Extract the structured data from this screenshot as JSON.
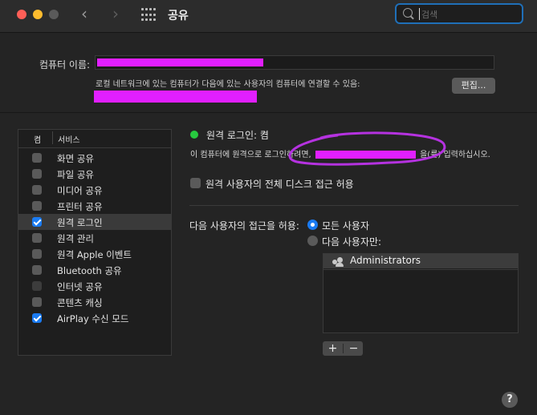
{
  "window": {
    "title": "공유",
    "search_placeholder": "검색",
    "traffic_colors": {
      "close": "#ff5f57",
      "minimize": "#febc2e",
      "zoom": "#5a5a5a"
    }
  },
  "computer_name": {
    "label": "컴퓨터 이름:",
    "info": "로컬 네트워크에 있는 컴퓨터가 다음에 있는 사용자의 컴퓨터에 연결할 수 있음:",
    "edit_button": "편집..."
  },
  "services": {
    "header_on": "켬",
    "header_service": "서비스",
    "items": [
      {
        "label": "화면 공유",
        "checked": false,
        "selected": false
      },
      {
        "label": "파일 공유",
        "checked": false,
        "selected": false
      },
      {
        "label": "미디어 공유",
        "checked": false,
        "selected": false
      },
      {
        "label": "프린터 공유",
        "checked": false,
        "selected": false
      },
      {
        "label": "원격 로그인",
        "checked": true,
        "selected": true
      },
      {
        "label": "원격 관리",
        "checked": false,
        "selected": false
      },
      {
        "label": "원격 Apple 이벤트",
        "checked": false,
        "selected": false
      },
      {
        "label": "Bluetooth 공유",
        "checked": false,
        "selected": false
      },
      {
        "label": "인터넷 공유",
        "checked": false,
        "selected": false
      },
      {
        "label": "콘텐츠 캐싱",
        "checked": false,
        "selected": false
      },
      {
        "label": "AirPlay 수신 모드",
        "checked": true,
        "selected": false
      }
    ]
  },
  "detail": {
    "status": "원격 로그인: 켬",
    "hint_prefix": "이 컴퓨터에 원격으로 로그인하려면,",
    "hint_suffix": "을(를) 입력하십시오.",
    "full_disk_label": "원격 사용자의 전체 디스크 접근 허용",
    "allow_label": "다음 사용자의 접근을 허용:",
    "radio_all": "모든 사용자",
    "radio_only": "다음 사용자만:",
    "users": [
      "Administrators"
    ],
    "add_label": "+",
    "remove_label": "−",
    "status_color": "#27c93f"
  },
  "help_label": "?",
  "accent_color": "#1a7bf2"
}
